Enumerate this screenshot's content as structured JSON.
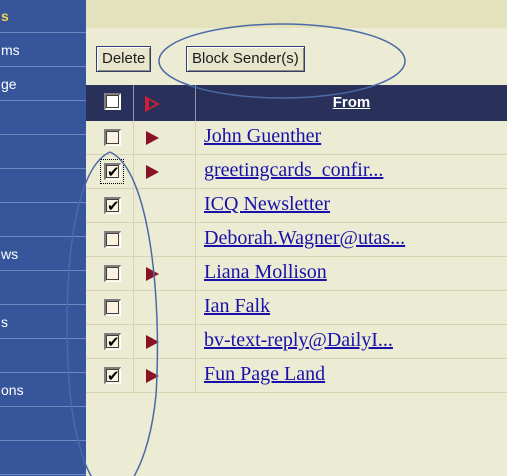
{
  "sidebar": {
    "items": [
      {
        "label": "s",
        "heading": true
      },
      {
        "label": "ms",
        "heading": false
      },
      {
        "label": "ge",
        "heading": false
      },
      {
        "label": "",
        "heading": false
      },
      {
        "label": "",
        "heading": false
      },
      {
        "label": "",
        "heading": false
      },
      {
        "label": "",
        "heading": false
      },
      {
        "label": "ws",
        "heading": false
      },
      {
        "label": "",
        "heading": false
      },
      {
        "label": "s",
        "heading": false
      },
      {
        "label": "",
        "heading": false
      },
      {
        "label": "ons",
        "heading": false
      },
      {
        "label": "",
        "heading": false
      },
      {
        "label": "",
        "heading": false
      }
    ]
  },
  "toolbar": {
    "delete_label": "Delete",
    "block_label": "Block Sender(s)"
  },
  "table": {
    "from_header": "From",
    "rows": [
      {
        "sender": "John Guenther",
        "checked": false,
        "flag": true
      },
      {
        "sender": "greetingcards_confir...",
        "checked": true,
        "flag": true,
        "focused": true
      },
      {
        "sender": "ICQ Newsletter",
        "checked": true,
        "flag": false
      },
      {
        "sender": "Deborah.Wagner@utas...",
        "checked": false,
        "flag": false
      },
      {
        "sender": "Liana Mollison",
        "checked": false,
        "flag": true
      },
      {
        "sender": "Ian Falk",
        "checked": false,
        "flag": false
      },
      {
        "sender": "bv-text-reply@DailyI...",
        "checked": true,
        "flag": true
      },
      {
        "sender": "Fun Page Land",
        "checked": true,
        "flag": true
      }
    ]
  },
  "colors": {
    "sidebar_bg": "#36559a",
    "sidebar_heading": "#f3d64d",
    "header_bg": "#29305a",
    "row_bg": "#ecebd4",
    "link": "#1810a8",
    "flag": "#8a1225",
    "annotation": "#4a6aa6"
  },
  "icons": {
    "flag": "flag-icon",
    "header_flag": "flag-header-icon",
    "check": "check-icon"
  }
}
